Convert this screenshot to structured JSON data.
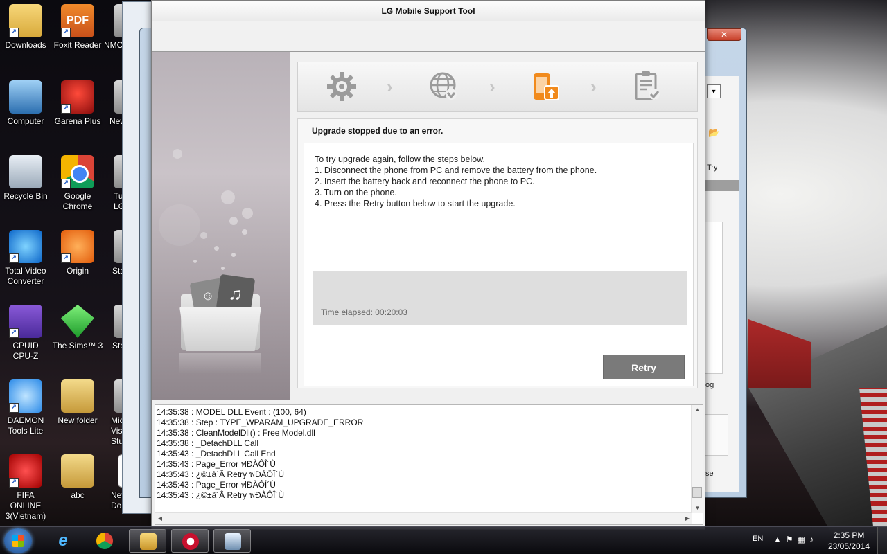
{
  "window": {
    "title": "LG Mobile Support Tool"
  },
  "steps": [
    {
      "icon": "gear-icon",
      "state": "done"
    },
    {
      "icon": "globe-download-icon",
      "state": "done"
    },
    {
      "icon": "phone-upgrade-icon",
      "state": "active"
    },
    {
      "icon": "checklist-icon",
      "state": "pending"
    }
  ],
  "status": {
    "title": "Upgrade stopped due to an error.",
    "instructions": [
      "To try upgrade again, follow the steps below.",
      "1. Disconnect the phone from PC and remove the battery from the phone.",
      "2. Insert the battery back and reconnect the phone to PC.",
      "3. Turn on the phone.",
      "4. Press the Retry button below to start the upgrade."
    ],
    "elapsed": "Time elapsed: 00:20:03",
    "retry_label": "Retry"
  },
  "log": [
    "14:35:38 : MODEL DLL Event : (100, 64)",
    "14:35:38 : Step : TYPE_WPARAM_UPGRADE_ERROR",
    "14:35:38 : CleanModelDll() :  Free Model.dll",
    "14:35:38 : _DetachDLL Call",
    "14:35:43 : _DetachDLL Call End",
    "14:35:43 : Page_Error ฟÐÀÔÎ´Ù",
    "14:35:43 : ¿©±â´Â Retry ฟÐÀÔÎ´Ù",
    "14:35:43 : Page_Error ฟÐÀÔÎ´Ù",
    "14:35:43 : ¿©±â´Â Retry ฟÐÀÔÎ´Ù"
  ],
  "desktop_icons": [
    {
      "label": "Downloads",
      "icon": "downloads-folder-icon"
    },
    {
      "label": "Foxit Reader",
      "icon": "foxit-pdf-icon"
    },
    {
      "label": "NMC",
      "icon": "partial-icon"
    },
    {
      "label": "Computer",
      "icon": "computer-icon"
    },
    {
      "label": "Garena Plus",
      "icon": "garena-icon"
    },
    {
      "label": "New",
      "icon": "partial-icon"
    },
    {
      "label": "Recycle Bin",
      "icon": "recycle-bin-icon"
    },
    {
      "label": "Google Chrome",
      "icon": "chrome-icon"
    },
    {
      "label": "Tu LG",
      "icon": "partial-icon"
    },
    {
      "label": "Total Video Converter",
      "icon": "total-video-converter-icon"
    },
    {
      "label": "Origin",
      "icon": "origin-icon"
    },
    {
      "label": "Sta",
      "icon": "partial-icon"
    },
    {
      "label": "CPUID CPU-Z",
      "icon": "cpuz-icon"
    },
    {
      "label": "The Sims™ 3",
      "icon": "sims3-icon"
    },
    {
      "label": "Ste",
      "icon": "partial-icon"
    },
    {
      "label": "DAEMON Tools Lite",
      "icon": "daemon-tools-icon"
    },
    {
      "label": "New folder",
      "icon": "folder-icon"
    },
    {
      "label": "Microso Visual Stu",
      "icon": "partial-icon"
    },
    {
      "label": "FIFA ONLINE 3(Vietnam)",
      "icon": "fifa-online-icon"
    },
    {
      "label": "abc",
      "icon": "folder-icon"
    },
    {
      "label": "New Tex Document",
      "icon": "text-document-icon"
    }
  ],
  "background_window": {
    "close_label": "✕",
    "try_label": "Try",
    "og_label": "og",
    "se_label": "se"
  },
  "taskbar": {
    "language": "EN",
    "time": "2:35 PM",
    "date": "23/05/2014"
  }
}
